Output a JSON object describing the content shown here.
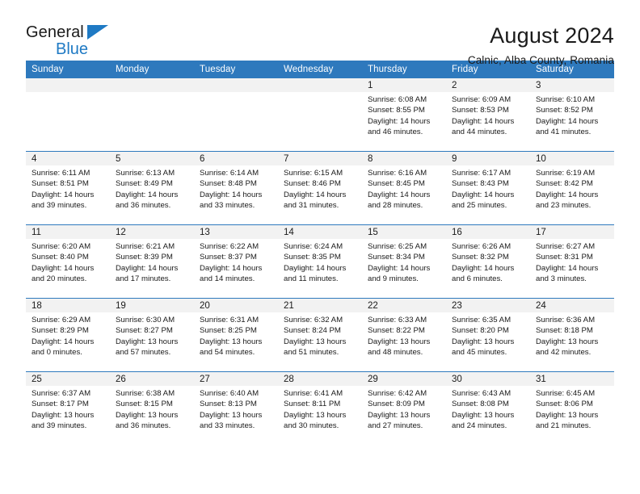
{
  "brand": {
    "name_line1": "General",
    "name_line2": "Blue",
    "triangle_icon": "triangle-icon"
  },
  "header": {
    "title": "August 2024",
    "subtitle": "Calnic, Alba County, Romania"
  },
  "colors": {
    "header_blue": "#2E79BD",
    "brand_blue": "#1F7AC4",
    "daynum_background": "#F2F2F2",
    "text": "#1A1A1A"
  },
  "calendar": {
    "weekday_headers": [
      "Sunday",
      "Monday",
      "Tuesday",
      "Wednesday",
      "Thursday",
      "Friday",
      "Saturday"
    ],
    "weeks": [
      [
        {
          "day": "",
          "empty": true
        },
        {
          "day": "",
          "empty": true
        },
        {
          "day": "",
          "empty": true
        },
        {
          "day": "",
          "empty": true
        },
        {
          "day": "1",
          "sunrise": "Sunrise: 6:08 AM",
          "sunset": "Sunset: 8:55 PM",
          "daylight_line1": "Daylight: 14 hours",
          "daylight_line2": "and 46 minutes."
        },
        {
          "day": "2",
          "sunrise": "Sunrise: 6:09 AM",
          "sunset": "Sunset: 8:53 PM",
          "daylight_line1": "Daylight: 14 hours",
          "daylight_line2": "and 44 minutes."
        },
        {
          "day": "3",
          "sunrise": "Sunrise: 6:10 AM",
          "sunset": "Sunset: 8:52 PM",
          "daylight_line1": "Daylight: 14 hours",
          "daylight_line2": "and 41 minutes."
        }
      ],
      [
        {
          "day": "4",
          "sunrise": "Sunrise: 6:11 AM",
          "sunset": "Sunset: 8:51 PM",
          "daylight_line1": "Daylight: 14 hours",
          "daylight_line2": "and 39 minutes."
        },
        {
          "day": "5",
          "sunrise": "Sunrise: 6:13 AM",
          "sunset": "Sunset: 8:49 PM",
          "daylight_line1": "Daylight: 14 hours",
          "daylight_line2": "and 36 minutes."
        },
        {
          "day": "6",
          "sunrise": "Sunrise: 6:14 AM",
          "sunset": "Sunset: 8:48 PM",
          "daylight_line1": "Daylight: 14 hours",
          "daylight_line2": "and 33 minutes."
        },
        {
          "day": "7",
          "sunrise": "Sunrise: 6:15 AM",
          "sunset": "Sunset: 8:46 PM",
          "daylight_line1": "Daylight: 14 hours",
          "daylight_line2": "and 31 minutes."
        },
        {
          "day": "8",
          "sunrise": "Sunrise: 6:16 AM",
          "sunset": "Sunset: 8:45 PM",
          "daylight_line1": "Daylight: 14 hours",
          "daylight_line2": "and 28 minutes."
        },
        {
          "day": "9",
          "sunrise": "Sunrise: 6:17 AM",
          "sunset": "Sunset: 8:43 PM",
          "daylight_line1": "Daylight: 14 hours",
          "daylight_line2": "and 25 minutes."
        },
        {
          "day": "10",
          "sunrise": "Sunrise: 6:19 AM",
          "sunset": "Sunset: 8:42 PM",
          "daylight_line1": "Daylight: 14 hours",
          "daylight_line2": "and 23 minutes."
        }
      ],
      [
        {
          "day": "11",
          "sunrise": "Sunrise: 6:20 AM",
          "sunset": "Sunset: 8:40 PM",
          "daylight_line1": "Daylight: 14 hours",
          "daylight_line2": "and 20 minutes."
        },
        {
          "day": "12",
          "sunrise": "Sunrise: 6:21 AM",
          "sunset": "Sunset: 8:39 PM",
          "daylight_line1": "Daylight: 14 hours",
          "daylight_line2": "and 17 minutes."
        },
        {
          "day": "13",
          "sunrise": "Sunrise: 6:22 AM",
          "sunset": "Sunset: 8:37 PM",
          "daylight_line1": "Daylight: 14 hours",
          "daylight_line2": "and 14 minutes."
        },
        {
          "day": "14",
          "sunrise": "Sunrise: 6:24 AM",
          "sunset": "Sunset: 8:35 PM",
          "daylight_line1": "Daylight: 14 hours",
          "daylight_line2": "and 11 minutes."
        },
        {
          "day": "15",
          "sunrise": "Sunrise: 6:25 AM",
          "sunset": "Sunset: 8:34 PM",
          "daylight_line1": "Daylight: 14 hours",
          "daylight_line2": "and 9 minutes."
        },
        {
          "day": "16",
          "sunrise": "Sunrise: 6:26 AM",
          "sunset": "Sunset: 8:32 PM",
          "daylight_line1": "Daylight: 14 hours",
          "daylight_line2": "and 6 minutes."
        },
        {
          "day": "17",
          "sunrise": "Sunrise: 6:27 AM",
          "sunset": "Sunset: 8:31 PM",
          "daylight_line1": "Daylight: 14 hours",
          "daylight_line2": "and 3 minutes."
        }
      ],
      [
        {
          "day": "18",
          "sunrise": "Sunrise: 6:29 AM",
          "sunset": "Sunset: 8:29 PM",
          "daylight_line1": "Daylight: 14 hours",
          "daylight_line2": "and 0 minutes."
        },
        {
          "day": "19",
          "sunrise": "Sunrise: 6:30 AM",
          "sunset": "Sunset: 8:27 PM",
          "daylight_line1": "Daylight: 13 hours",
          "daylight_line2": "and 57 minutes."
        },
        {
          "day": "20",
          "sunrise": "Sunrise: 6:31 AM",
          "sunset": "Sunset: 8:25 PM",
          "daylight_line1": "Daylight: 13 hours",
          "daylight_line2": "and 54 minutes."
        },
        {
          "day": "21",
          "sunrise": "Sunrise: 6:32 AM",
          "sunset": "Sunset: 8:24 PM",
          "daylight_line1": "Daylight: 13 hours",
          "daylight_line2": "and 51 minutes."
        },
        {
          "day": "22",
          "sunrise": "Sunrise: 6:33 AM",
          "sunset": "Sunset: 8:22 PM",
          "daylight_line1": "Daylight: 13 hours",
          "daylight_line2": "and 48 minutes."
        },
        {
          "day": "23",
          "sunrise": "Sunrise: 6:35 AM",
          "sunset": "Sunset: 8:20 PM",
          "daylight_line1": "Daylight: 13 hours",
          "daylight_line2": "and 45 minutes."
        },
        {
          "day": "24",
          "sunrise": "Sunrise: 6:36 AM",
          "sunset": "Sunset: 8:18 PM",
          "daylight_line1": "Daylight: 13 hours",
          "daylight_line2": "and 42 minutes."
        }
      ],
      [
        {
          "day": "25",
          "sunrise": "Sunrise: 6:37 AM",
          "sunset": "Sunset: 8:17 PM",
          "daylight_line1": "Daylight: 13 hours",
          "daylight_line2": "and 39 minutes."
        },
        {
          "day": "26",
          "sunrise": "Sunrise: 6:38 AM",
          "sunset": "Sunset: 8:15 PM",
          "daylight_line1": "Daylight: 13 hours",
          "daylight_line2": "and 36 minutes."
        },
        {
          "day": "27",
          "sunrise": "Sunrise: 6:40 AM",
          "sunset": "Sunset: 8:13 PM",
          "daylight_line1": "Daylight: 13 hours",
          "daylight_line2": "and 33 minutes."
        },
        {
          "day": "28",
          "sunrise": "Sunrise: 6:41 AM",
          "sunset": "Sunset: 8:11 PM",
          "daylight_line1": "Daylight: 13 hours",
          "daylight_line2": "and 30 minutes."
        },
        {
          "day": "29",
          "sunrise": "Sunrise: 6:42 AM",
          "sunset": "Sunset: 8:09 PM",
          "daylight_line1": "Daylight: 13 hours",
          "daylight_line2": "and 27 minutes."
        },
        {
          "day": "30",
          "sunrise": "Sunrise: 6:43 AM",
          "sunset": "Sunset: 8:08 PM",
          "daylight_line1": "Daylight: 13 hours",
          "daylight_line2": "and 24 minutes."
        },
        {
          "day": "31",
          "sunrise": "Sunrise: 6:45 AM",
          "sunset": "Sunset: 8:06 PM",
          "daylight_line1": "Daylight: 13 hours",
          "daylight_line2": "and 21 minutes."
        }
      ]
    ]
  }
}
